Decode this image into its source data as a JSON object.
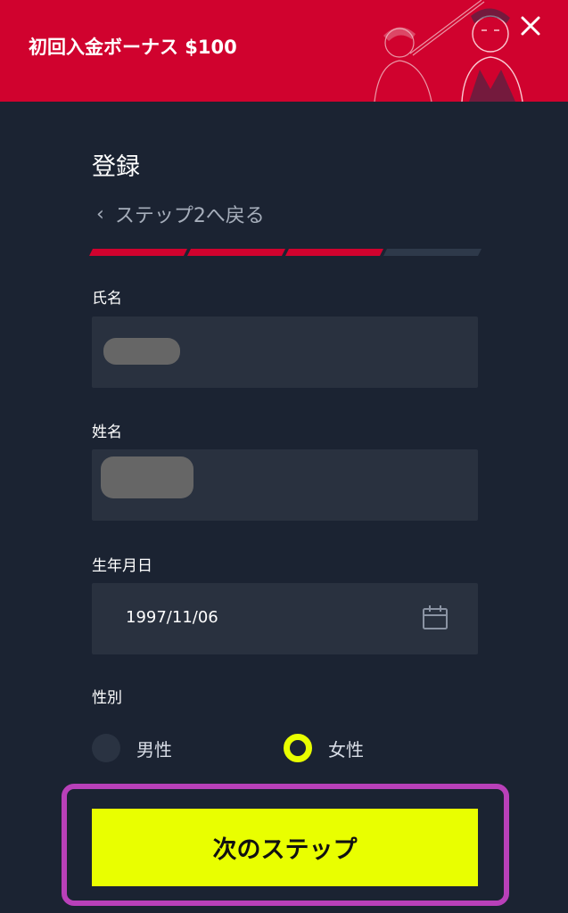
{
  "banner": {
    "title": "初回入金ボーナス $100",
    "background_color": "#d0022e",
    "close_icon": "close-icon"
  },
  "form": {
    "title": "登録",
    "back_link": "ステップ2へ戻る",
    "progress": {
      "steps_total": 4,
      "steps_completed": 3,
      "active_color": "#d0022e",
      "inactive_color": "#2e394a"
    },
    "fields": {
      "family_name": {
        "label": "氏名",
        "value_redacted": true
      },
      "given_name": {
        "label": "姓名",
        "value_redacted": true
      },
      "birthdate": {
        "label": "生年月日",
        "value": "1997/11/06",
        "icon": "calendar-icon"
      }
    },
    "gender": {
      "label": "性別",
      "options": [
        {
          "label": "男性",
          "selected": false
        },
        {
          "label": "女性",
          "selected": true
        }
      ]
    },
    "next_button": {
      "label": "次のステップ",
      "color": "#e9ff00"
    }
  },
  "highlight_color": "#b940b9"
}
